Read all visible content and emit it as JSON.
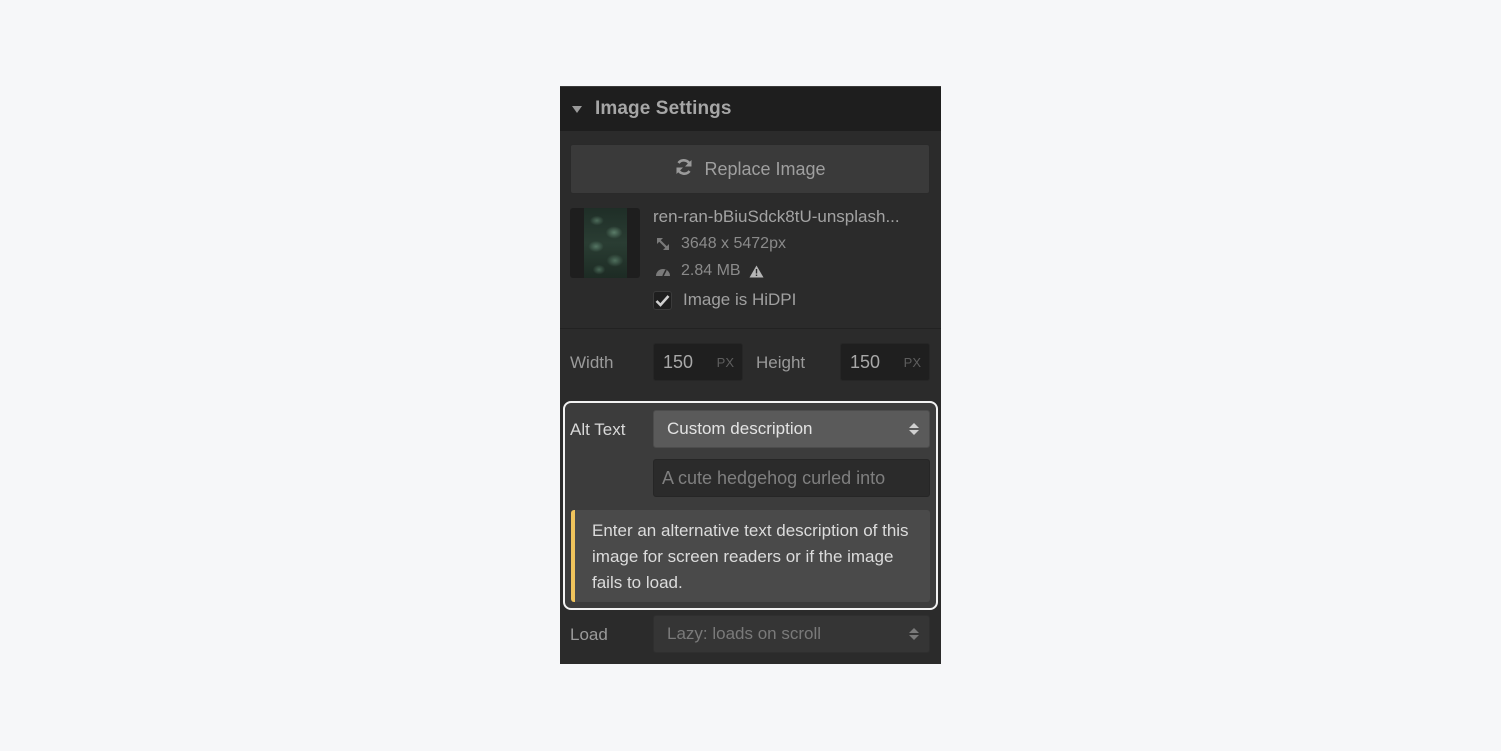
{
  "panel": {
    "title": "Image Settings",
    "caret_icon": "caret-down-icon"
  },
  "replace_button": {
    "label": "Replace Image",
    "icon": "refresh-icon"
  },
  "file": {
    "name": "ren-ran-bBiuSdck8tU-unsplash...",
    "dimensions": "3648 x 5472px",
    "dimensions_icon": "resize-icon",
    "size": "2.84 MB",
    "size_icon": "gauge-icon",
    "warning_icon": "warning-triangle-icon",
    "thumbnail": "leaves-thumbnail"
  },
  "hidpi": {
    "label": "Image is HiDPI",
    "checked": true
  },
  "size_fields": {
    "width_label": "Width",
    "width_value": "150",
    "width_unit": "PX",
    "height_label": "Height",
    "height_value": "150",
    "height_unit": "PX"
  },
  "alt_text": {
    "label": "Alt Text",
    "selected_option": "Custom description",
    "input_value": "A cute hedgehog curled into",
    "hint": "Enter an alternative text description of this image for screen readers or if the image fails to load.",
    "hint_accent": "#f0c45c"
  },
  "load": {
    "label": "Load",
    "selected_option": "Lazy: loads on scroll"
  }
}
